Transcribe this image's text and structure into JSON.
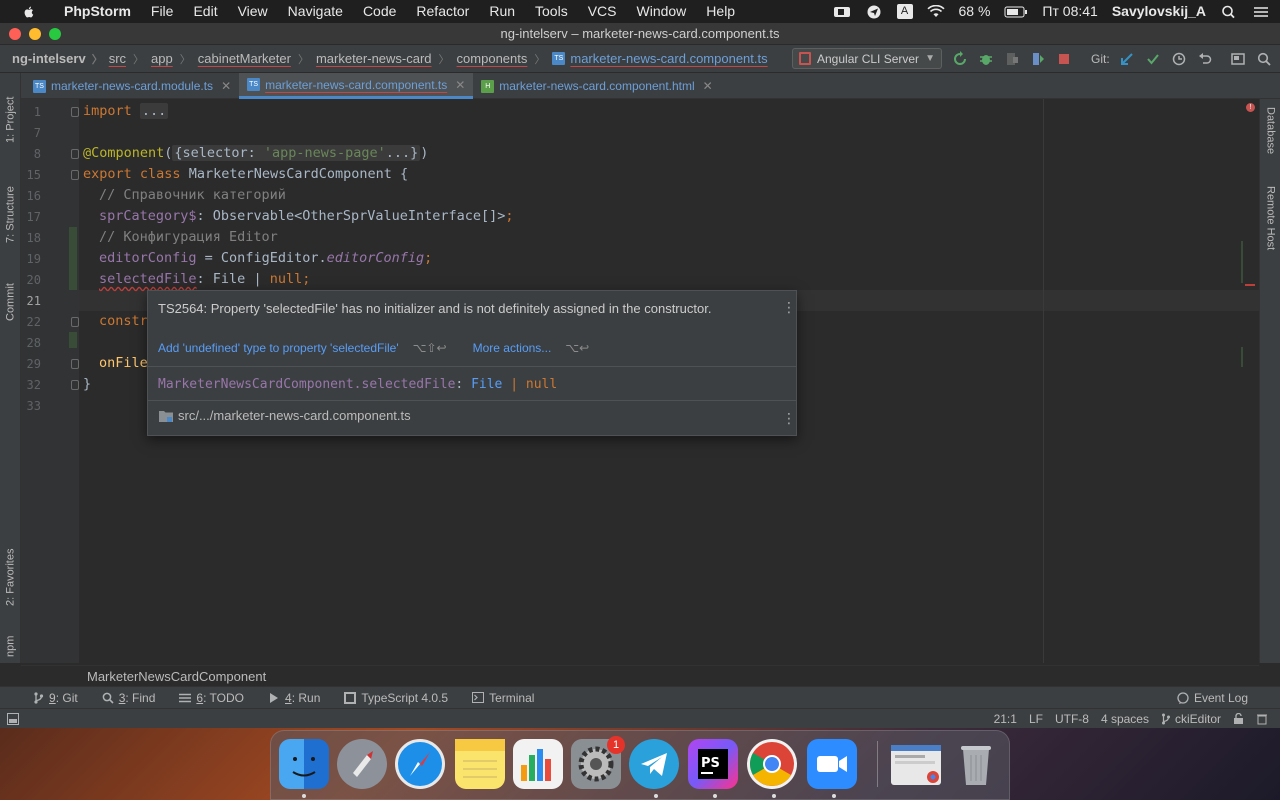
{
  "menubar": {
    "items": [
      "PhpStorm",
      "File",
      "Edit",
      "View",
      "Navigate",
      "Code",
      "Refactor",
      "Run",
      "Tools",
      "VCS",
      "Window",
      "Help"
    ],
    "battery": "68 %",
    "input_source": "A",
    "clock": "Пт 08:41",
    "user": "Savylovskij_A"
  },
  "window": {
    "title": "ng-intelserv – marketer-news-card.component.ts"
  },
  "navbar": {
    "crumbs": [
      "ng-intelserv",
      "src",
      "app",
      "cabinetMarketer",
      "marketer-news-card",
      "components",
      "marketer-news-card.component.ts"
    ],
    "run_config": "Angular CLI Server",
    "git_label": "Git:"
  },
  "tabs": [
    {
      "label": "marketer-news-card.module.ts",
      "type": "ts",
      "active": false
    },
    {
      "label": "marketer-news-card.component.ts",
      "type": "ts",
      "active": true
    },
    {
      "label": "marketer-news-card.component.html",
      "type": "html",
      "active": false
    }
  ],
  "left_stripe": {
    "project": "1: Project",
    "structure": "7: Structure",
    "commit": "Commit",
    "favorites": "2: Favorites",
    "npm": "npm"
  },
  "right_stripe": {
    "database": "Database",
    "remote_host": "Remote Host"
  },
  "editor": {
    "line_numbers": [
      "1",
      "7",
      "8",
      "15",
      "16",
      "17",
      "18",
      "19",
      "20",
      "21",
      "22",
      "28",
      "29",
      "32",
      "33"
    ],
    "code": {
      "l1_kw": "import",
      "l1_fold": "...",
      "l8_ann": "@Component",
      "l8_open": "(",
      "l8_fold_a": "{selector: ",
      "l8_fold_str": "'app-news-page'",
      "l8_fold_b": "...}",
      "l8_close": ")",
      "l15_kw1": "export",
      "l15_kw2": "class",
      "l15_name": "MarketerNewsCardComponent",
      "l15_brace": " {",
      "l16_comment": "// Справочник категорий",
      "l17_field": "sprCategory$",
      "l17_rest": ": Observable<OtherSprValueInterface[]>",
      "l17_semi": ";",
      "l18_comment": "// Конфигурация Editor",
      "l19_field": "editorConfig",
      "l19_rest": " = ConfigEditor.",
      "l19_member": "editorConfig",
      "l19_semi": ";",
      "l20_field": "selectedFile",
      "l20_rest": ": File | ",
      "l20_null": "null",
      "l20_semi": ";",
      "l22_text": "constr",
      "l29_text": "onFile",
      "l32_brace": "}"
    }
  },
  "popup": {
    "message": "TS2564: Property 'selectedFile' has no initializer and is not definitely assigned in the constructor.",
    "action_primary": "Add 'undefined' type to property 'selectedFile'",
    "action_primary_key": "⌥⇧↩",
    "action_more": "More actions...",
    "action_more_key": "⌥↩",
    "sig_owner": "MarketerNewsCardComponent.selectedFile",
    "sig_colon": ":",
    "sig_type": "File",
    "sig_pipe": "|",
    "sig_null": "null",
    "path": "src/.../marketer-news-card.component.ts"
  },
  "editor_breadcrumb": "MarketerNewsCardComponent",
  "tool_windows": [
    {
      "num": "9",
      "label": ": Git"
    },
    {
      "num": "3",
      "label": ": Find"
    },
    {
      "num": "6",
      "label": ": TODO"
    },
    {
      "num": "4",
      "label": ": Run"
    },
    {
      "num": "",
      "label": "TypeScript 4.0.5"
    },
    {
      "num": "",
      "label": "Terminal"
    }
  ],
  "event_log": "Event Log",
  "status": {
    "position": "21:1",
    "line_sep": "LF",
    "encoding": "UTF-8",
    "indent": "4 spaces",
    "branch": "ckiEditor"
  },
  "dock": {
    "settings_badge": "1"
  },
  "colors": {
    "accent": "#4a88c7",
    "error": "#bc3f3c",
    "link": "#589df6"
  }
}
